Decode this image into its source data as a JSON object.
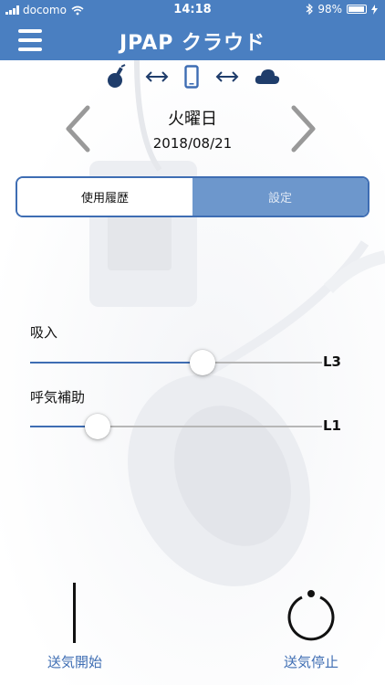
{
  "status_bar": {
    "carrier": "docomo",
    "time": "14:18",
    "battery": "98%"
  },
  "nav": {
    "title": "JPAP クラウド"
  },
  "date_nav": {
    "day": "火曜日",
    "date": "2018/08/21"
  },
  "tabs": [
    {
      "label": "使用履歴",
      "active": true
    },
    {
      "label": "設定",
      "active": false
    }
  ],
  "sliders": {
    "inhale": {
      "label": "吸入",
      "value_label": "L3",
      "level_fraction": 0.59
    },
    "exhale_assist": {
      "label": "呼気補助",
      "value_label": "L1",
      "level_fraction": 0.23
    }
  },
  "actions": {
    "start_label": "送気開始",
    "stop_label": "送気停止"
  },
  "colors": {
    "primary": "#4a7fc1",
    "accent": "#3e6db3",
    "tab_inactive": "#6d97cc",
    "icon_dark": "#1f3d6b"
  },
  "icons": {
    "menu": "hamburger-menu-icon",
    "device": "device-plug-icon",
    "sync": "left-right-arrow-icon",
    "phone": "smartphone-icon",
    "cloud": "cloud-icon",
    "prev": "chevron-left-icon",
    "next": "chevron-right-icon",
    "start": "start-bar-icon",
    "stop": "power-icon"
  }
}
